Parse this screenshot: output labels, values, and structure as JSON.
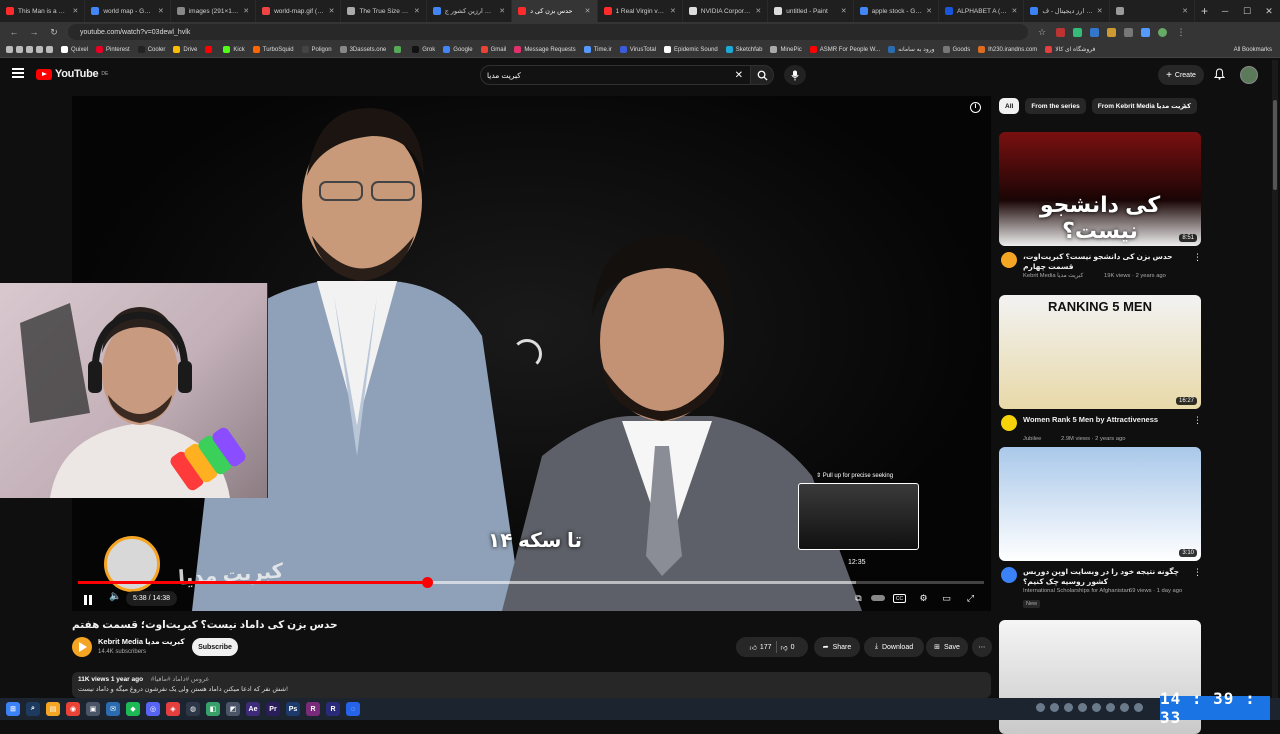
{
  "browser": {
    "tabs": [
      {
        "title": "This Man is a Menu",
        "color": "#ff2b2b",
        "active": false
      },
      {
        "title": "world map - Googl",
        "color": "#4285f4",
        "active": false
      },
      {
        "title": "images (291×173)",
        "color": "#888888",
        "active": false
      },
      {
        "title": "world-map.gif (120",
        "color": "#e44",
        "active": false
      },
      {
        "title": "The True Size Of...",
        "color": "#aaaaaa",
        "active": false
      },
      {
        "title": "پهلوی ارزین کشور ج",
        "color": "#4285f4",
        "active": false
      },
      {
        "title": "حدس بزن کی د",
        "color": "#ff2b2b",
        "active": true
      },
      {
        "title": "1 Real Virgin vs 5 F",
        "color": "#ff2b2b",
        "active": false
      },
      {
        "title": "NVIDIA Corporation",
        "color": "#dddddd",
        "active": false
      },
      {
        "title": "untitled - Paint",
        "color": "#dddddd",
        "active": false
      },
      {
        "title": "apple stock - Goog",
        "color": "#4285f4",
        "active": false
      },
      {
        "title": "ALPHABET A (EX G",
        "color": "#1a56db",
        "active": false
      },
      {
        "title": "خرید ارز دیجیتال - ف",
        "color": "#3b82f6",
        "active": false
      },
      {
        "title": "",
        "color": "#999999",
        "active": false
      }
    ],
    "url": "youtube.com/watch?v=03dewl_hvlk",
    "bookmarks": [
      {
        "label": "Quixel",
        "color": "#ffffff"
      },
      {
        "label": "Pinterest",
        "color": "#e60023"
      },
      {
        "label": "Cooler",
        "color": "#222222"
      },
      {
        "label": "Drive",
        "color": "#fbbc04"
      },
      {
        "label": "",
        "color": "#ff0000"
      },
      {
        "label": "Kick",
        "color": "#53fc18"
      },
      {
        "label": "TurboSquid",
        "color": "#ff6600"
      },
      {
        "label": "Poligon",
        "color": "#444444"
      },
      {
        "label": "3Dassets.one",
        "color": "#888888"
      },
      {
        "label": "",
        "color": "#55aa55"
      },
      {
        "label": "Grok",
        "color": "#111111"
      },
      {
        "label": "Google",
        "color": "#4285f4"
      },
      {
        "label": "Gmail",
        "color": "#ea4335"
      },
      {
        "label": "Message Requests",
        "color": "#e1306c"
      },
      {
        "label": "Time.ir",
        "color": "#5599ff"
      },
      {
        "label": "VirusTotal",
        "color": "#3b5bdb"
      },
      {
        "label": "Epidemic Sound",
        "color": "#ffffff"
      },
      {
        "label": "Sketchfab",
        "color": "#1caad9"
      },
      {
        "label": "MinePic",
        "color": "#aaaaaa"
      },
      {
        "label": "ASMR For People W...",
        "color": "#ff0000"
      },
      {
        "label": "ورود به سامانه",
        "color": "#2b6cb0"
      },
      {
        "label": "Goods",
        "color": "#777777"
      },
      {
        "label": "lh230.irandns.com",
        "color": "#dd6b20"
      },
      {
        "label": "فروشگاه ای کالا",
        "color": "#e53e3e"
      }
    ],
    "all_bookmarks": "All Bookmarks"
  },
  "youtube": {
    "logo_text": "YouTube",
    "logo_region": "DE",
    "search_query": "کبریت مدیا",
    "create_label": "Create"
  },
  "player": {
    "subtitle": "۱۴ تا سکه",
    "watermark": "کبریت مدیا",
    "preview_hint": "⇕ Pull up for precise seeking",
    "preview_time": "12:35",
    "time_display": "5:38 / 14:38",
    "progress_fraction": 0.385,
    "hover_fraction": 0.859
  },
  "video": {
    "title": "حدس بزن کی داماد نیست؟ کبریت‌اوت؛ قسمت هفتم",
    "channel": "Kebrit Media کبریت مدیا",
    "subscribers": "14.4K subscribers",
    "subscribe_label": "Subscribe",
    "likes": "177",
    "dislikes": "0",
    "share_label": "Share",
    "download_label": "Download",
    "save_label": "Save",
    "views_date": "11K views  1 year ago",
    "tags": "#عروس #داماد #مافیا",
    "description": "شش نفر که ادعا میکنن داماد هستن ولی یک نفرشون دروغ میگه و داماد نیست!"
  },
  "sidebar": {
    "chips": [
      "All",
      "From the series",
      "From Kebrit Media کبریت مدیا"
    ],
    "recommendations": [
      {
        "title": "حدس بزن کی دانشجو نیست؟ کبریت‌اوت، قسمت چهارم",
        "channel": "Kebrit Media کبریت مدیا",
        "meta": "19K views · 2 years ago",
        "duration": "8:51",
        "thumb_text": "کی دانشجو نیست؟",
        "color": "#f5a524",
        "new": ""
      },
      {
        "title": "Women Rank 5 Men by Attractiveness",
        "channel": "Jubilee",
        "meta": "2.9M views · 2 years ago",
        "duration": "16:27",
        "thumb_text": "RANKING 5 MEN",
        "color": "#f5d20a",
        "new": ""
      },
      {
        "title": "چگونه نتیجه خود را در وبسایت اوپن دوربس کشور روسیه چک کنیم؟",
        "channel": "International Scholarships for Afghanistan",
        "meta": "69 views · 1 day ago",
        "duration": "3:10",
        "thumb_text": "",
        "color": "#3b82f6",
        "new": "New"
      },
      {
        "title": "",
        "channel": "",
        "meta": "",
        "duration": "",
        "thumb_text": "",
        "color": "#888888",
        "new": ""
      }
    ]
  },
  "taskbar": {
    "apps": [
      "⊞",
      "⌕",
      "▤",
      "◉",
      "▣",
      "✉",
      "◆",
      "◎",
      "◈",
      "◍",
      "◧",
      "◩",
      "Ae",
      "Pr",
      "Ps",
      "R",
      "R",
      "◌"
    ],
    "clock": "14 : 39 : 33"
  }
}
